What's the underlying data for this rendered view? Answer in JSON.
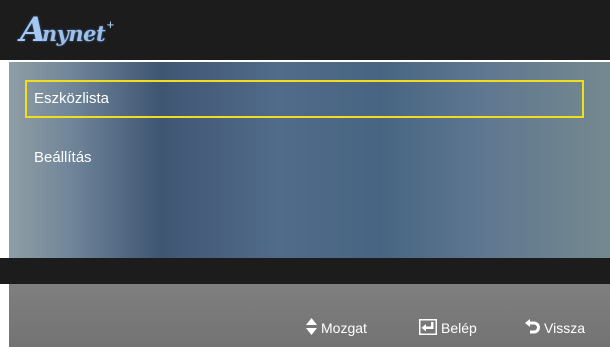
{
  "logo": {
    "first_letter": "A",
    "rest": "nynet",
    "mark": "+"
  },
  "menu": {
    "items": [
      {
        "label": "Eszközlista",
        "selected": true
      },
      {
        "label": "Beállítás",
        "selected": false
      }
    ]
  },
  "footer": {
    "hints": [
      {
        "icon": "up-down-arrows-icon",
        "label": "Mozgat"
      },
      {
        "icon": "enter-icon",
        "label": "Belép"
      },
      {
        "icon": "return-icon",
        "label": "Vissza"
      }
    ]
  },
  "colors": {
    "selection_border": "#f2dc1e",
    "title_bar": "#1c1c1c",
    "footer": "#7f7f7f"
  }
}
